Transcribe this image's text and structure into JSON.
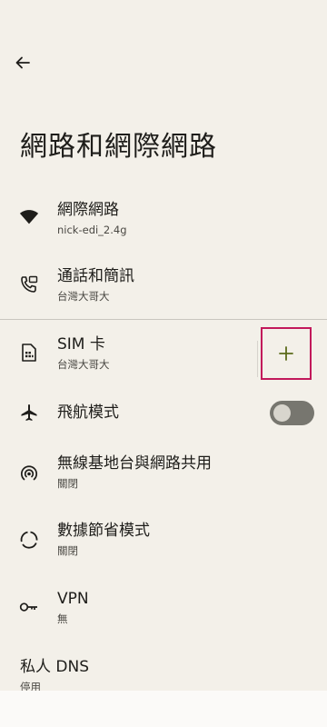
{
  "header": {
    "back_icon": "arrow-left-icon",
    "title": "網路和網際網路"
  },
  "items": [
    {
      "label": "網際網路",
      "sub": "nick-edi_2.4g",
      "icon": "wifi-icon"
    },
    {
      "label": "通話和簡訊",
      "sub": "台灣大哥大",
      "icon": "call-sms-icon"
    },
    {
      "label": "SIM 卡",
      "sub": "台灣大哥大",
      "icon": "sim-card-icon",
      "action_icon": "plus-icon"
    },
    {
      "label": "飛航模式",
      "icon": "airplane-icon",
      "toggle_on": false
    },
    {
      "label": "無線基地台與網路共用",
      "sub": "關閉",
      "icon": "hotspot-icon"
    },
    {
      "label": "數據節省模式",
      "sub": "關閉",
      "icon": "data-saver-icon"
    },
    {
      "label": "VPN",
      "sub": "無",
      "icon": "vpn-key-icon"
    },
    {
      "label": "私人 DNS",
      "sub": "停用"
    }
  ],
  "colors": {
    "background": "#f3f0e9",
    "accent": "#5b6b1a",
    "highlight_border": "#c2185b",
    "toggle_track": "#77766f"
  }
}
